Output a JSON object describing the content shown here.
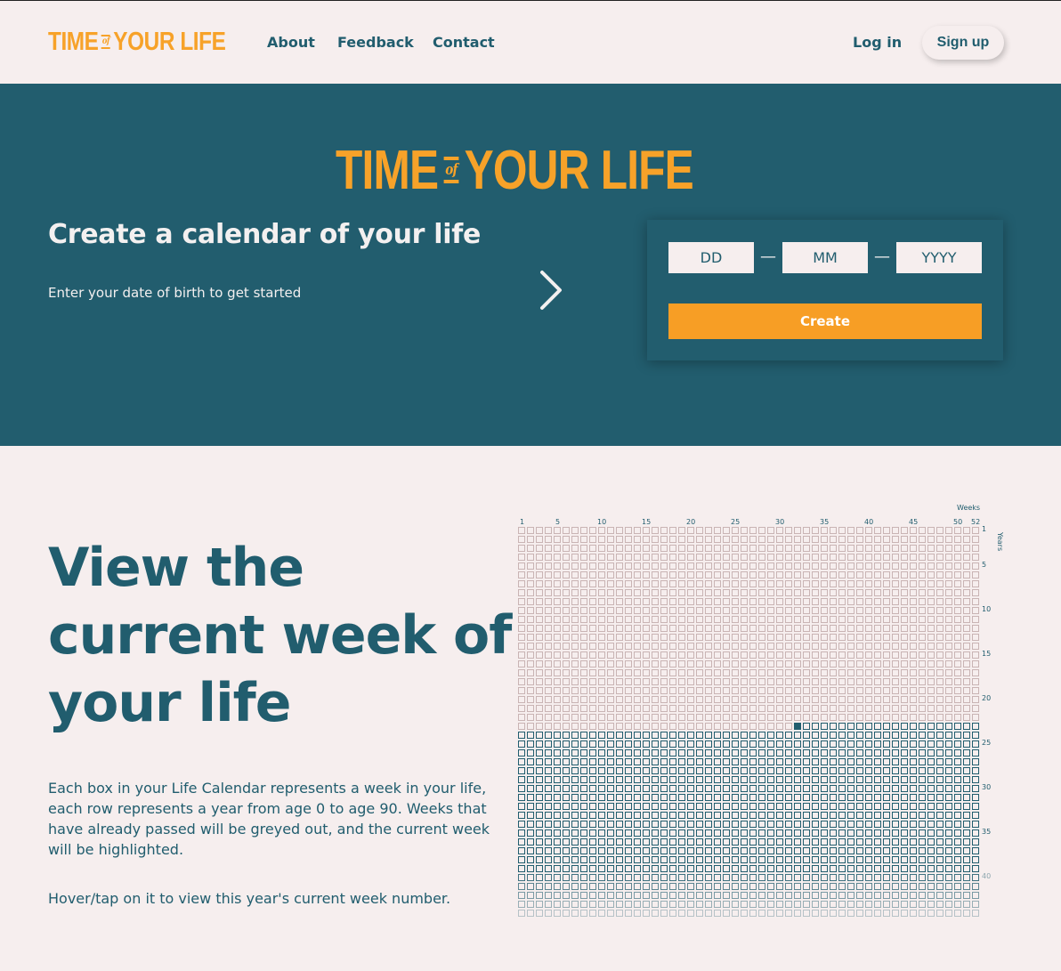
{
  "nav": {
    "brand_left": "TIME",
    "brand_of": "of",
    "brand_right": "YOUR LIFE",
    "links": [
      "About",
      "Feedback",
      "Contact"
    ],
    "login": "Log in",
    "signup": "Sign up"
  },
  "hero": {
    "brand_left": "TIME",
    "brand_of": "of",
    "brand_right": "YOUR LIFE",
    "title": "Create a calendar of your life",
    "subtitle": "Enter your date of birth to get started",
    "dd_placeholder": "DD",
    "mm_placeholder": "MM",
    "yyyy_placeholder": "YYYY",
    "separator": "—",
    "create_label": "Create",
    "chevron_icon": "chevron-right-icon"
  },
  "section": {
    "title_line1": "View the",
    "title_line2": "current week of",
    "title_line3": "your life",
    "para1": "Each box in your Life Calendar represents a week in your life, each row represents a year from age 0 to age 90. Weeks that have already passed will be greyed out, and the current week will be highlighted.",
    "para2": "Hover/tap on it to view this year's current week number."
  },
  "calendar": {
    "weeks_label": "Weeks",
    "years_label": "Years",
    "week_ticks": [
      "1",
      "5",
      "10",
      "15",
      "20",
      "25",
      "30",
      "35",
      "40",
      "45",
      "50",
      "52"
    ],
    "year_ticks": [
      "1",
      "5",
      "10",
      "15",
      "20",
      "25",
      "30",
      "35",
      "40"
    ],
    "weeks_per_year": 52,
    "rows_visible": 44,
    "current_year_index": 22,
    "current_week_index": 31,
    "colors": {
      "passed": "#c9b4b4",
      "future": "#215d6e",
      "current": "#215d6e"
    }
  }
}
